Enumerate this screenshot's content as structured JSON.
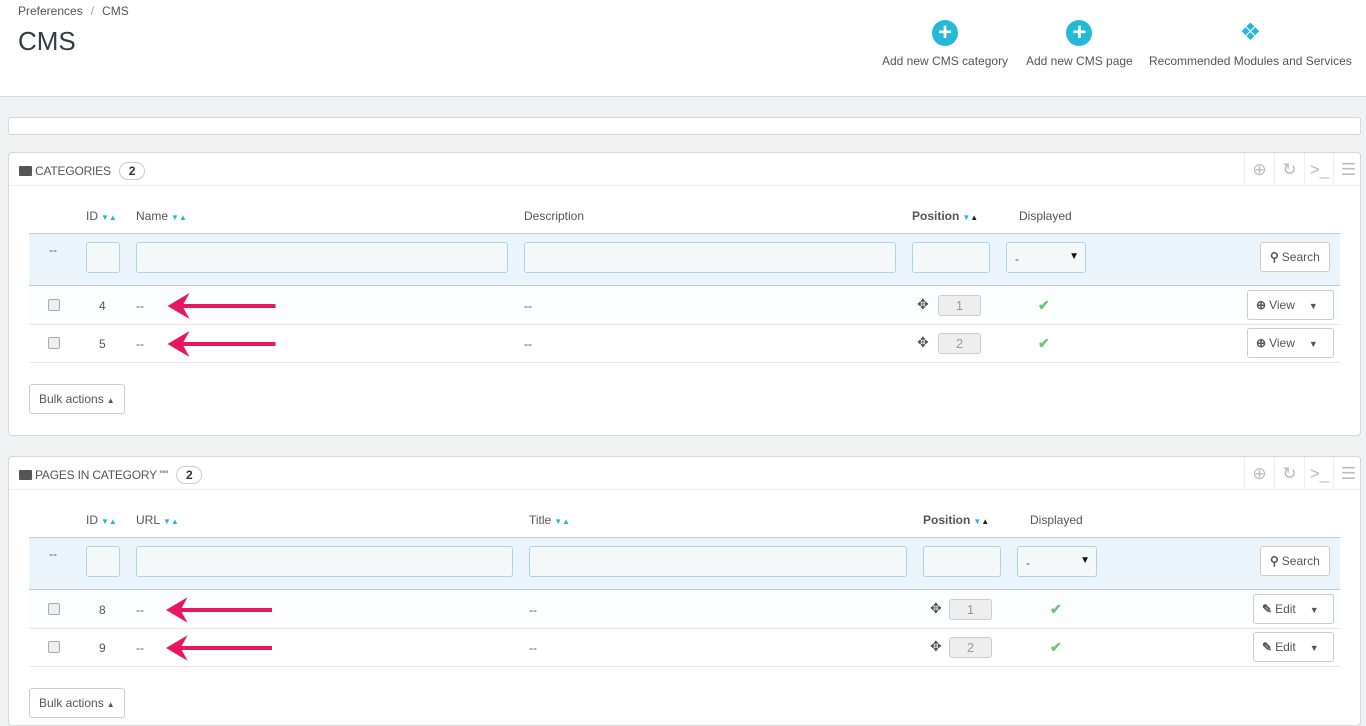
{
  "breadcrumb": [
    "Preferences",
    "CMS"
  ],
  "page_title": "CMS",
  "toolbar": [
    {
      "label": "Add new CMS category",
      "icon": "plus-circle-icon"
    },
    {
      "label": "Add new CMS page",
      "icon": "plus-circle-icon"
    },
    {
      "label": "Recommended Modules and Services",
      "icon": "puzzle-icon"
    }
  ],
  "colors": {
    "accent": "#25b9d7",
    "arrow": "#e8175d",
    "check": "#72c279"
  },
  "panels": [
    {
      "title": "Categories",
      "count": "2",
      "headers": [
        {
          "label": "ID",
          "sort": true
        },
        {
          "label": "Name",
          "sort": true
        },
        {
          "label": "Description",
          "sort": false
        },
        {
          "label": "Position",
          "sort": true,
          "active": true
        },
        {
          "label": "Displayed",
          "sort": false
        }
      ],
      "filter": {
        "dash": "--",
        "displayed_value": "-",
        "search_label": "Search"
      },
      "rows": [
        {
          "id": "4",
          "c1": "--",
          "c2": "--",
          "position": "1",
          "action": "View"
        },
        {
          "id": "5",
          "c1": "--",
          "c2": "--",
          "position": "2",
          "action": "View"
        }
      ],
      "bulk_label": "Bulk actions"
    },
    {
      "title": "Pages in category \"\"",
      "count": "2",
      "headers": [
        {
          "label": "ID",
          "sort": true
        },
        {
          "label": "URL",
          "sort": true
        },
        {
          "label": "Title",
          "sort": true
        },
        {
          "label": "Position",
          "sort": true,
          "active": true
        },
        {
          "label": "Displayed",
          "sort": false
        }
      ],
      "filter": {
        "dash": "--",
        "displayed_value": "-",
        "search_label": "Search"
      },
      "rows": [
        {
          "id": "8",
          "c1": "--",
          "c2": "--",
          "position": "1",
          "action": "Edit"
        },
        {
          "id": "9",
          "c1": "--",
          "c2": "--",
          "position": "2",
          "action": "Edit"
        }
      ],
      "bulk_label": "Bulk actions"
    }
  ]
}
